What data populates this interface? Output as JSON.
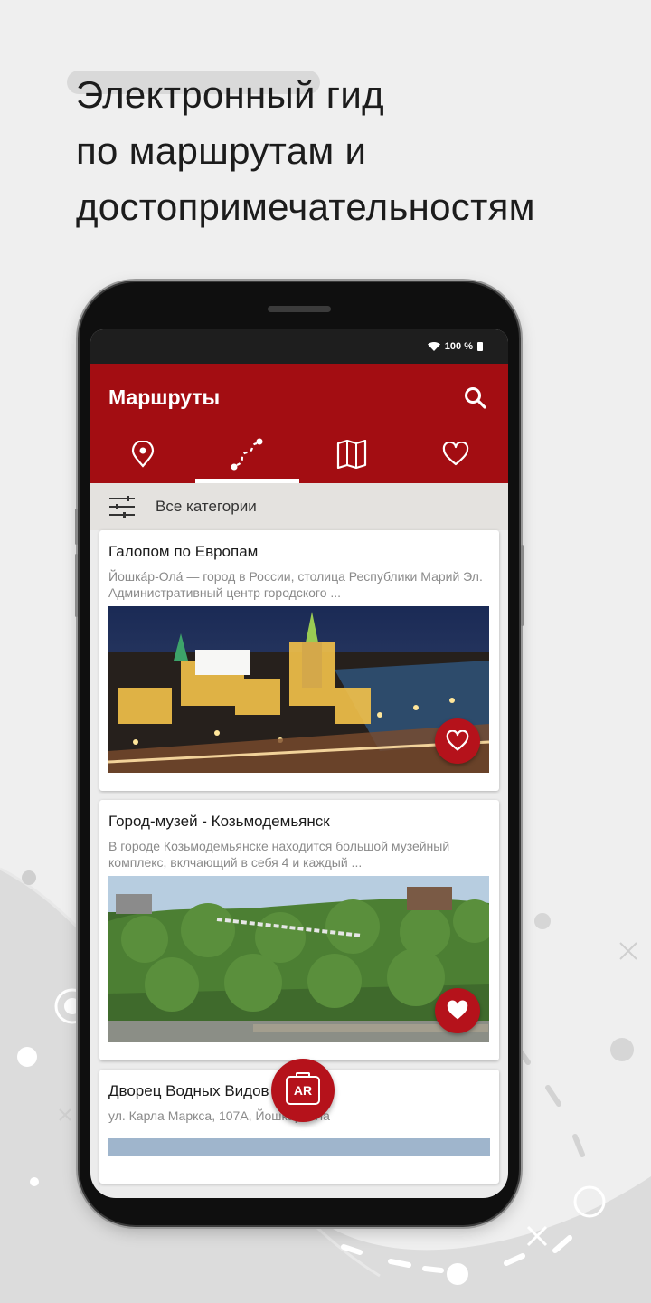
{
  "headline": {
    "line1": "Электронный гид",
    "line2": "по маршрутам и",
    "line3": "достопримечательностям"
  },
  "status_bar": {
    "battery_text": "100 %"
  },
  "app_bar": {
    "title": "Маршруты",
    "color": "#a30d12",
    "tabs": [
      {
        "icon": "location-pin-icon",
        "active": false
      },
      {
        "icon": "route-icon",
        "active": true
      },
      {
        "icon": "map-icon",
        "active": false
      },
      {
        "icon": "heart-outline-icon",
        "active": false
      }
    ]
  },
  "filter": {
    "label": "Все категории",
    "icon": "sliders-icon"
  },
  "routes": [
    {
      "title": "Галопом по Европам",
      "description": "Йошка́р-Ола́ — город в России, столица Республики Марий Эл. Административный центр городского ...",
      "favorite": false
    },
    {
      "title": "Город-музей - Козьмодемьянск",
      "description": "В городе Козьмодемьянске находится большой музейный комплекс, вклчающий в себя 4 и каждый ...",
      "favorite": true
    },
    {
      "title": "Дворец Водных Видов спорта",
      "description": "ул. Карла Маркса, 107А, Йошкар-Ола"
    }
  ],
  "ar_button": {
    "label": "AR"
  }
}
